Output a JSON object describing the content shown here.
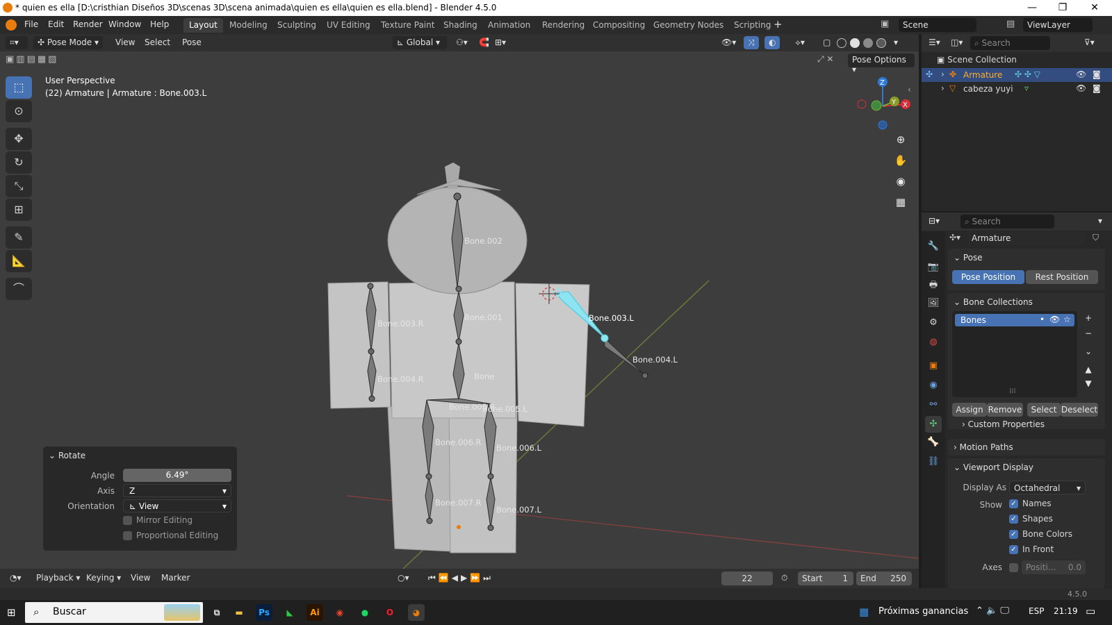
{
  "window": {
    "title": "* quien es ella [D:\\cristhian Diseños 3D\\scenas 3D\\scena animada\\quien es ella\\quien es ella.blend] - Blender 4.5.0",
    "minimize": "—",
    "maximize": "❐",
    "close": "✕"
  },
  "menu": {
    "items": [
      "File",
      "Edit",
      "Render",
      "Window",
      "Help"
    ],
    "workspaces": [
      "Layout",
      "Modeling",
      "Sculpting",
      "UV Editing",
      "Texture Paint",
      "Shading",
      "Animation",
      "Rendering",
      "Compositing",
      "Geometry Nodes",
      "Scripting"
    ],
    "active_workspace": "Layout",
    "add_tab": "+",
    "scene": "Scene",
    "view_layer": "ViewLayer"
  },
  "viewport_header": {
    "mode": "Pose Mode",
    "menus": [
      "View",
      "Select",
      "Pose"
    ],
    "orientation": "Global"
  },
  "viewport": {
    "perspective": "User Perspective",
    "active": "(22) Armature | Armature : Bone.003.L",
    "pose_options": "Pose Options",
    "bones": [
      "Bone.002",
      "Bone.003.R",
      "Bone.001",
      "Bone.003.L",
      "Bone.004.L",
      "Bone.004.R",
      "Bone",
      "Bone.005.R",
      "Bone.005.L",
      "Bone.006.R",
      "Bone.006.L",
      "Bone.007.R",
      "Bone.007.L"
    ],
    "gizmo": {
      "x": "X",
      "y": "Y",
      "z": "Z"
    }
  },
  "rotate_panel": {
    "title": "Rotate",
    "angle_label": "Angle",
    "angle": "6.49°",
    "axis_label": "Axis",
    "axis": "Z",
    "orientation_label": "Orientation",
    "orientation": "View",
    "mirror": "Mirror Editing",
    "proportional": "Proportional Editing"
  },
  "timeline": {
    "menus": [
      "Playback",
      "Keying",
      "View",
      "Marker"
    ],
    "current_frame": "22",
    "start_label": "Start",
    "start": "1",
    "end_label": "End",
    "end": "250"
  },
  "outliner": {
    "search_placeholder": "Search",
    "collection": "Scene Collection",
    "items": [
      "Armature",
      "cabeza yuyi"
    ]
  },
  "properties": {
    "search_placeholder": "Search",
    "object": "Armature",
    "pose_section": "Pose",
    "pose_position": "Pose Position",
    "rest_position": "Rest Position",
    "bone_collections_section": "Bone Collections",
    "collection_item": "Bones",
    "assign": "Assign",
    "remove": "Remove",
    "select": "Select",
    "deselect": "Deselect",
    "custom_properties": "Custom Properties",
    "motion_paths": "Motion Paths",
    "viewport_display": "Viewport Display",
    "display_as_label": "Display As",
    "display_as": "Octahedral",
    "show_label": "Show",
    "show_names": "Names",
    "show_shapes": "Shapes",
    "show_bone_colors": "Bone Colors",
    "show_in_front": "In Front",
    "axes_label": "Axes",
    "axes_position": "Positi...",
    "axes_value": "0.0"
  },
  "statusbar": {
    "version": "4.5.0"
  },
  "taskbar": {
    "search": "Buscar",
    "weather": "Próximas ganancias",
    "language": "ESP",
    "time": "21:19"
  },
  "colors": {
    "accent": "#4772b3",
    "orange": "#e87d0d",
    "selected_bone": "#5fd0e0",
    "viewport_bg": "#3d3d3d"
  }
}
